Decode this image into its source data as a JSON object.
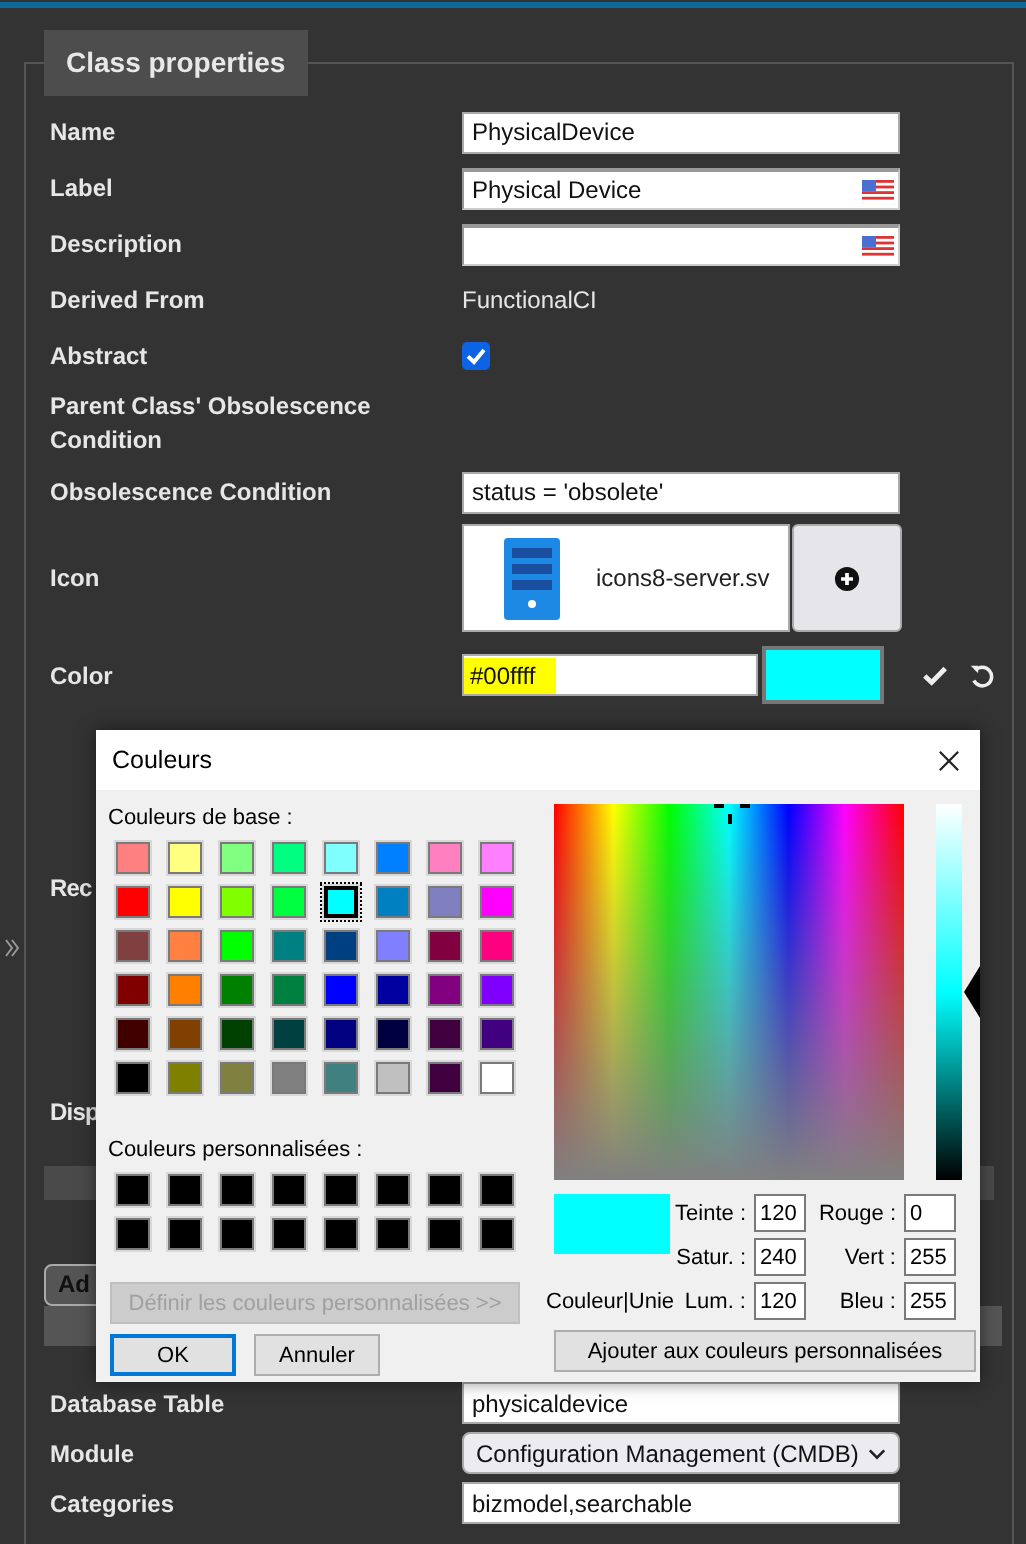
{
  "legend": "Class properties",
  "fields": [
    {
      "kind": "text",
      "label": "Name",
      "value": "PhysicalDevice"
    },
    {
      "kind": "translatable",
      "label": "Label",
      "value": "Physical Device"
    },
    {
      "kind": "translatable",
      "label": "Description"
    },
    {
      "kind": "static",
      "label": "Derived From",
      "value": "FunctionalCI"
    },
    {
      "kind": "checkbox",
      "label": "Abstract",
      "checked": true
    },
    {
      "kind": "heading",
      "label": "Parent Class' Obsolescence Condition"
    },
    {
      "kind": "text",
      "label": "Obsolescence Condition",
      "value": "status = 'obsolete'"
    },
    {
      "kind": "icon",
      "label": "Icon",
      "value": "icons8-server.sv"
    },
    {
      "kind": "color",
      "label": "Color",
      "value": "#00ffff"
    }
  ],
  "covered_labels": [
    "Rec",
    "Disp"
  ],
  "tab": {
    "label": "Ad",
    "selected": true
  },
  "lower_fields": [
    {
      "kind": "text",
      "label": "Database Table",
      "value": "physicaldevice"
    },
    {
      "kind": "select",
      "label": "Module",
      "value": "Configuration Management (CMDB)"
    },
    {
      "kind": "text",
      "label": "Categories",
      "value": "bizmodel,searchable"
    }
  ],
  "dialog": {
    "title": "Couleurs",
    "basic_label": "Couleurs de base :",
    "basic_colors": [
      {
        "color": "#ff8080",
        "selected": false
      },
      {
        "color": "#ffff80",
        "selected": false
      },
      {
        "color": "#80ff80",
        "selected": false
      },
      {
        "color": "#00ff80",
        "selected": false
      },
      {
        "color": "#80ffff",
        "selected": false
      },
      {
        "color": "#0080ff",
        "selected": false
      },
      {
        "color": "#ff80c0",
        "selected": false
      },
      {
        "color": "#ff80ff",
        "selected": false
      },
      {
        "color": "#ff0000",
        "selected": false
      },
      {
        "color": "#ffff00",
        "selected": false
      },
      {
        "color": "#80ff00",
        "selected": false
      },
      {
        "color": "#00ff40",
        "selected": false
      },
      {
        "color": "#00ffff",
        "selected": true
      },
      {
        "color": "#0080c0",
        "selected": false
      },
      {
        "color": "#8080c0",
        "selected": false
      },
      {
        "color": "#ff00ff",
        "selected": false
      },
      {
        "color": "#804040",
        "selected": false
      },
      {
        "color": "#ff8040",
        "selected": false
      },
      {
        "color": "#00ff00",
        "selected": false
      },
      {
        "color": "#008080",
        "selected": false
      },
      {
        "color": "#004080",
        "selected": false
      },
      {
        "color": "#8080ff",
        "selected": false
      },
      {
        "color": "#800040",
        "selected": false
      },
      {
        "color": "#ff0080",
        "selected": false
      },
      {
        "color": "#800000",
        "selected": false
      },
      {
        "color": "#ff8000",
        "selected": false
      },
      {
        "color": "#008000",
        "selected": false
      },
      {
        "color": "#008040",
        "selected": false
      },
      {
        "color": "#0000ff",
        "selected": false
      },
      {
        "color": "#0000a0",
        "selected": false
      },
      {
        "color": "#800080",
        "selected": false
      },
      {
        "color": "#8000ff",
        "selected": false
      },
      {
        "color": "#400000",
        "selected": false
      },
      {
        "color": "#804000",
        "selected": false
      },
      {
        "color": "#004000",
        "selected": false
      },
      {
        "color": "#004040",
        "selected": false
      },
      {
        "color": "#000080",
        "selected": false
      },
      {
        "color": "#000040",
        "selected": false
      },
      {
        "color": "#400040",
        "selected": false
      },
      {
        "color": "#400080",
        "selected": false
      },
      {
        "color": "#000000",
        "selected": false
      },
      {
        "color": "#808000",
        "selected": false
      },
      {
        "color": "#808040",
        "selected": false
      },
      {
        "color": "#808080",
        "selected": false
      },
      {
        "color": "#408080",
        "selected": false
      },
      {
        "color": "#c0c0c0",
        "selected": false
      },
      {
        "color": "#400040",
        "selected": false
      },
      {
        "color": "#ffffff",
        "selected": false
      }
    ],
    "custom_label": "Couleurs personnalisées :",
    "custom_colors": [
      {
        "color": "#000000"
      },
      {
        "color": "#000000"
      },
      {
        "color": "#000000"
      },
      {
        "color": "#000000"
      },
      {
        "color": "#000000"
      },
      {
        "color": "#000000"
      },
      {
        "color": "#000000"
      },
      {
        "color": "#000000"
      },
      {
        "color": "#000000"
      },
      {
        "color": "#000000"
      },
      {
        "color": "#000000"
      },
      {
        "color": "#000000"
      },
      {
        "color": "#000000"
      },
      {
        "color": "#000000"
      },
      {
        "color": "#000000"
      },
      {
        "color": "#000000"
      }
    ],
    "define_button": {
      "label": "Définir les couleurs personnalisées >>",
      "disabled": true
    },
    "ok": "OK",
    "cancel": "Annuler",
    "preview_label": "Couleur|Unie",
    "hsl": [
      {
        "label": "Teinte :",
        "value": "120"
      },
      {
        "label": "Satur. :",
        "value": "240"
      },
      {
        "label": "Lum. :",
        "value": "120"
      }
    ],
    "rgb": [
      {
        "label": "Rouge :",
        "value": "0"
      },
      {
        "label": "Vert :",
        "value": "255"
      },
      {
        "label": "Bleu :",
        "value": "255"
      }
    ],
    "add_button": "Ajouter aux couleurs personnalisées"
  }
}
